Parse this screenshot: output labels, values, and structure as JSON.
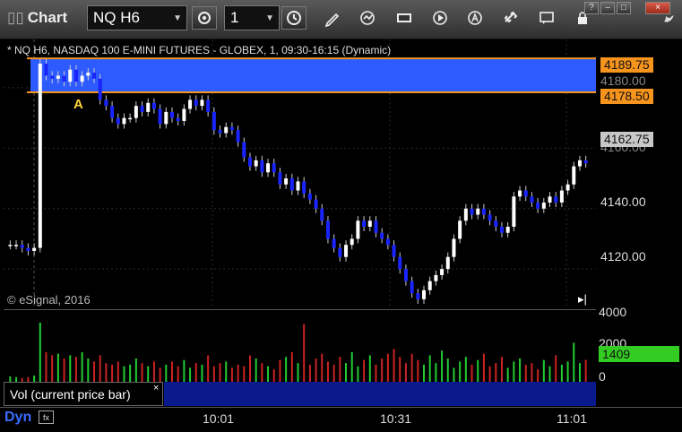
{
  "toolbar": {
    "title": "Chart",
    "symbol": "NQ H6",
    "interval": "1",
    "window_buttons": [
      "?",
      "–",
      "□",
      "×"
    ]
  },
  "chart": {
    "description": "* NQ H6, NASDAQ 100 E-MINI FUTURES - GLOBEX, 1, 09:30-16:15 (Dynamic)",
    "annotation": "A",
    "copyright": "© eSignal, 2016"
  },
  "price_axis": {
    "ticks": [
      "4140.00",
      "4120.00"
    ],
    "hidden_ticks": [
      "4180.00",
      "4160.00"
    ],
    "badges": [
      {
        "label": "4189.75",
        "color": "#f7941d"
      },
      {
        "label": "4178.50",
        "color": "#f7941d"
      },
      {
        "label": "4162.75",
        "color": "#c8c8c8"
      }
    ]
  },
  "volume_axis": {
    "ticks": [
      "4000",
      "2000",
      "0"
    ],
    "badge": {
      "label": "1409",
      "color": "#33cc22"
    }
  },
  "study": {
    "label": "Vol (current price bar)",
    "close": "×"
  },
  "time_axis": {
    "mode": "Dyn",
    "ticks": [
      "10:01",
      "10:31",
      "11:01"
    ]
  },
  "colors": {
    "up": "#ffffff",
    "down": "#1a24ff",
    "zone": "#2e5bff",
    "zone_border": "#f7941d",
    "vol_up": "#22cc33",
    "vol_down": "#cc2222"
  },
  "chart_data": {
    "type": "candlestick",
    "ylim": [
      4107,
      4196
    ],
    "zone": [
      4178.5,
      4189.75
    ],
    "closes": [
      4128,
      4128,
      4127,
      4126,
      4127,
      4188,
      4184,
      4183,
      4184,
      4182,
      4186,
      4182,
      4184,
      4185,
      4183,
      4176,
      4174,
      4170,
      4168,
      4170,
      4170,
      4174,
      4172,
      4175,
      4173,
      4168,
      4172,
      4170,
      4169,
      4173,
      4176,
      4174,
      4176,
      4172,
      4166,
      4165,
      4167,
      4166,
      4162,
      4157,
      4154,
      4156,
      4152,
      4155,
      4152,
      4148,
      4150,
      4146,
      4149,
      4145,
      4143,
      4140,
      4136,
      4130,
      4127,
      4124,
      4128,
      4130,
      4136,
      4134,
      4136,
      4132,
      4130,
      4128,
      4124,
      4120,
      4116,
      4112,
      4110,
      4113,
      4116,
      4118,
      4120,
      4124,
      4130,
      4136,
      4140,
      4138,
      4140,
      4138,
      4136,
      4134,
      4132,
      4134,
      4144,
      4146,
      4144,
      4142,
      4140,
      4142,
      4144,
      4142,
      4146,
      4148,
      4154,
      4156,
      4155
    ],
    "volumes": [
      350,
      300,
      250,
      300,
      400,
      3800,
      1900,
      1700,
      1800,
      1500,
      1700,
      1600,
      1900,
      1500,
      1300,
      1700,
      1200,
      1100,
      1300,
      1000,
      1100,
      1500,
      1200,
      1000,
      1300,
      900,
      1100,
      1300,
      1000,
      1400,
      900,
      1200,
      1100,
      1700,
      1000,
      1200,
      1300,
      900,
      1100,
      1000,
      1700,
      1500,
      1200,
      1000,
      800,
      1400,
      1600,
      1900,
      1200,
      3700,
      1100,
      1500,
      1800,
      1300,
      1100,
      1600,
      1200,
      1900,
      1000,
      1400,
      1700,
      1100,
      1500,
      1800,
      2100,
      1600,
      1200,
      1800,
      1400,
      1100,
      1700,
      1200,
      2000,
      1500,
      900,
      1300,
      1600,
      1100,
      1400,
      1800,
      1000,
      1200,
      1600,
      900,
      1300,
      1500,
      1100,
      1200,
      800,
      1400,
      1000,
      1700,
      1100,
      1300,
      2500,
      1200,
      1409
    ]
  }
}
